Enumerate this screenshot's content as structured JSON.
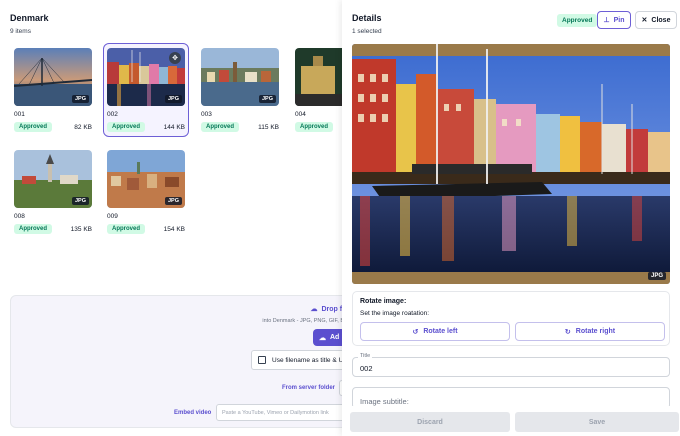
{
  "gallery": {
    "title": "Denmark",
    "count": "9 items",
    "items": [
      {
        "name": "001",
        "status": "Approved",
        "size": "82 KB",
        "format": "JPG"
      },
      {
        "name": "002",
        "status": "Approved",
        "size": "144 KB",
        "format": "JPG",
        "selected": true
      },
      {
        "name": "003",
        "status": "Approved",
        "size": "115 KB",
        "format": "JPG"
      },
      {
        "name": "004",
        "status": "Approved",
        "size": "",
        "format": "JPG"
      },
      {
        "name": "008",
        "status": "Approved",
        "size": "135 KB",
        "format": "JPG"
      },
      {
        "name": "009",
        "status": "Approved",
        "size": "154 KB",
        "format": "JPG"
      }
    ]
  },
  "upload": {
    "drop_title": "Drop fi",
    "drop_sub": "into Denmark - JPG, PNG, GIF, B",
    "add_label": "Ad",
    "checkbox_label": "Use filename as title & U",
    "server_label": "From server folder",
    "embed_label": "Embed video",
    "embed_placeholder": "Paste a YouTube, Vimeo or Dailymotion link"
  },
  "details": {
    "title": "Details",
    "subtitle": "1 selected",
    "status": "Approved",
    "pin_label": "Pin",
    "close_label": "Close",
    "format": "JPG",
    "rotate_title": "Rotate image:",
    "rotate_sub": "Set the image roatation:",
    "rotate_left": "Rotate left",
    "rotate_right": "Rotate right",
    "title_label": "Title",
    "title_value": "002",
    "subtitle_placeholder": "Image subtitle:",
    "discard_label": "Discard",
    "save_label": "Save"
  },
  "colors": {
    "accent": "#5b4fcf",
    "approved_bg": "#d1fae5",
    "approved_text": "#047857"
  },
  "icons": {
    "select": "move-icon",
    "pin": "pin-icon",
    "close": "close-icon",
    "upload": "cloud-upload-icon",
    "rotate_left": "rotate-left-icon",
    "rotate_right": "rotate-right-icon"
  }
}
